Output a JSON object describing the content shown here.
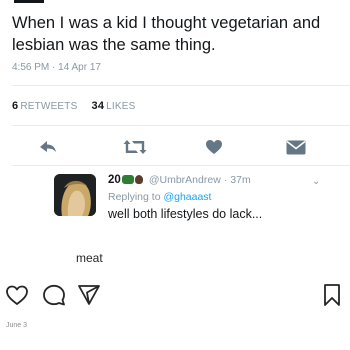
{
  "tweet": {
    "text": "When I was a kid I thought vegetarian and lesbian was the same thing.",
    "timestamp": "4:56 PM · 14 Apr 17",
    "retweets_count": "6",
    "retweets_label": "RETWEETS",
    "likes_count": "34",
    "likes_label": "LIKES"
  },
  "tweet_actions": [
    {
      "icon": "reply-icon"
    },
    {
      "icon": "retweet-icon"
    },
    {
      "icon": "heart-icon"
    },
    {
      "icon": "direct-message-icon"
    }
  ],
  "reply": {
    "name": "20",
    "handle": "@UmbrAndrew",
    "time": "· 37m",
    "replying_prefix": "Replying to",
    "replying_to": "@ghaaast",
    "text": "well both lifestyles do lack..."
  },
  "instagram": {
    "caption": "meat",
    "date": "June 3",
    "icons": [
      "heart-icon",
      "comment-icon",
      "share-icon",
      "bookmark-icon"
    ]
  },
  "colors": {
    "muted": "#8899a6",
    "link": "#1da1f2",
    "text": "#14171a",
    "icon": "#657786"
  }
}
